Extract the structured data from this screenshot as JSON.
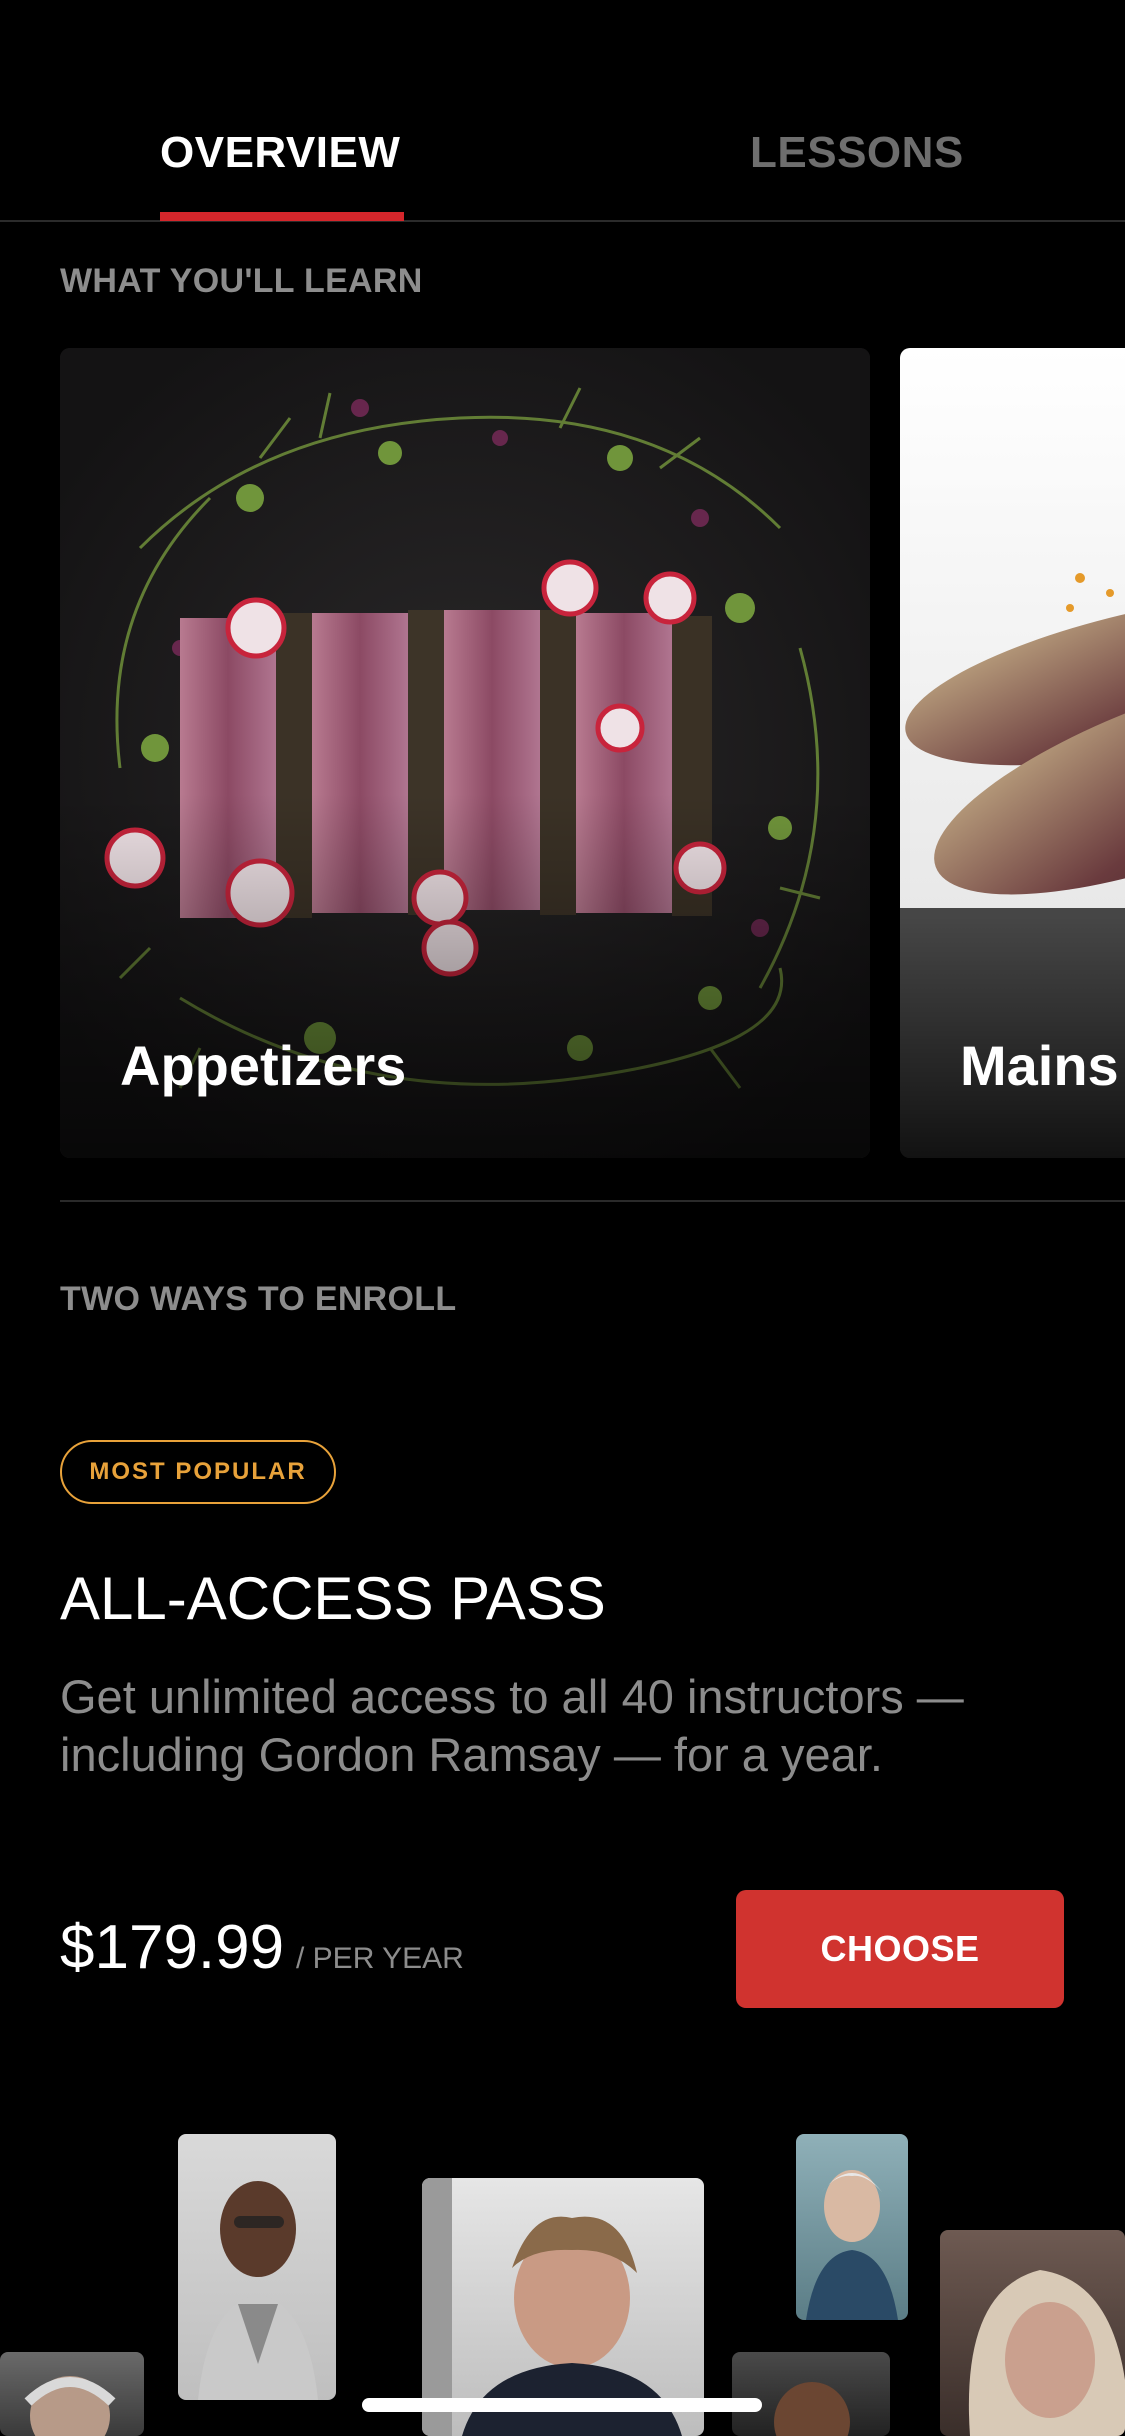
{
  "tabs": {
    "overview": "OVERVIEW",
    "lessons": "LESSONS"
  },
  "learn": {
    "heading": "WHAT YOU'LL LEARN",
    "cards": [
      {
        "label": "Appetizers"
      },
      {
        "label": "Mains"
      }
    ]
  },
  "enroll": {
    "heading": "TWO WAYS TO ENROLL",
    "badge": "MOST POPULAR",
    "plan_title": "ALL-ACCESS PASS",
    "description": "Get unlimited access to all 40 instructors — including Gordon Ramsay — for a year.",
    "price": "$179.99",
    "period": "/ PER YEAR",
    "button": "CHOOSE"
  },
  "colors": {
    "accent": "#d0332f",
    "badge": "#e8a23a",
    "background": "#000000"
  }
}
